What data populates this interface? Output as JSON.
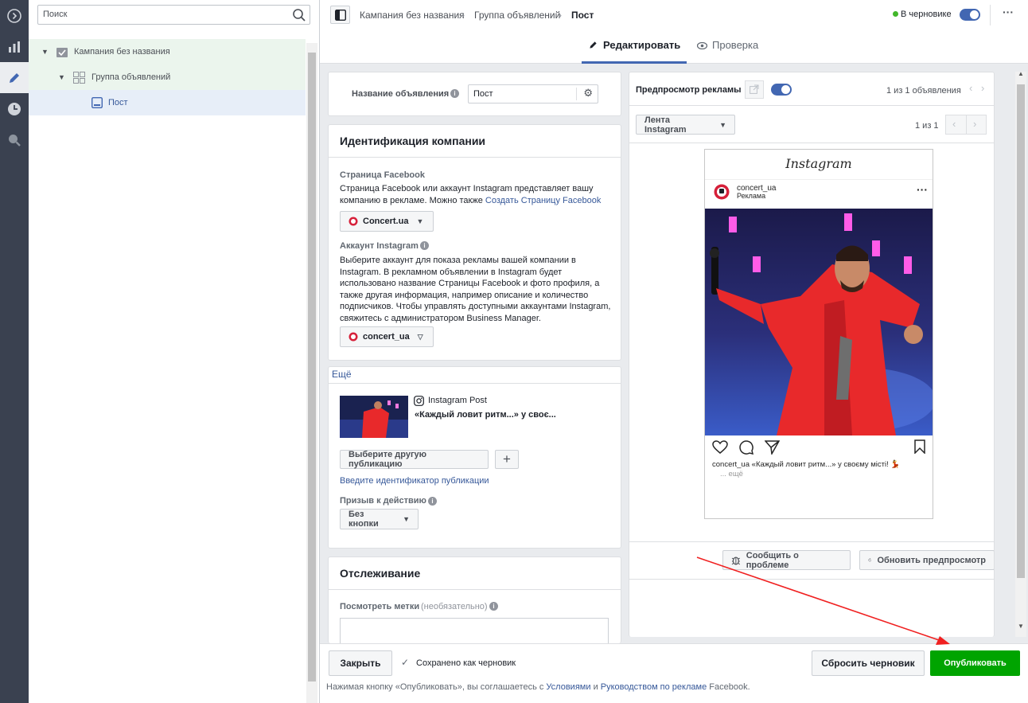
{
  "search": {
    "placeholder": "Поиск"
  },
  "tree": {
    "campaign": "Кампания без названия",
    "adset": "Группа объявлений",
    "ad": "Пост"
  },
  "breadcrumb": {
    "campaign": "Кампания без названия",
    "adset": "Группа объявлений",
    "ad": "Пост"
  },
  "status": {
    "draft": "В черновике"
  },
  "tabs": {
    "edit": "Редактировать",
    "review": "Проверка"
  },
  "adname": {
    "label": "Название объявления",
    "value": "Пост"
  },
  "identity": {
    "title": "Идентификация компании",
    "fb_label": "Страница Facebook",
    "fb_desc": "Страница Facebook или аккаунт Instagram представляет вашу компанию в рекламе. Можно также",
    "fb_link": "Создать Страницу Facebook",
    "fb_page": "Concert.ua",
    "ig_label": "Аккаунт Instagram",
    "ig_desc": "Выберите аккаунт для показа рекламы вашей компании в Instagram. В рекламном объявлении в Instagram будет использовано название Страницы Facebook и фото профиля, а также другая информация, например описание и количество подписчиков. Чтобы управлять доступными аккаунтами Instagram, свяжитесь с администратором Business Manager.",
    "ig_account": "concert_ua"
  },
  "more": {
    "label": "Ещё",
    "post_type": "Instagram Post",
    "post_caption": "«Каждый ловит ритм...» у своє...",
    "choose_btn": "Выберите другую публикацию",
    "enter_id": "Введите идентификатор публикации",
    "cta_label": "Призыв к действию",
    "cta_value": "Без кнопки"
  },
  "tracking": {
    "title": "Отслеживание",
    "tags_label": "Посмотреть метки",
    "tags_optional": "(необязательно)"
  },
  "preview": {
    "title": "Предпросмотр рекламы",
    "count": "1 из 1 объявления",
    "placement": "Лента Instagram",
    "page": "1 из 1",
    "ig_logo": "Instagram",
    "account": "concert_ua",
    "sponsored": "Реклама",
    "caption_user": "concert_ua",
    "caption": "«Каждый ловит ритм...» у своєму місті! 💃",
    "more": "... ещё",
    "report_btn": "Сообщить о проблеме",
    "refresh_btn": "Обновить предпросмотр"
  },
  "footer": {
    "close": "Закрыть",
    "saved": "Сохранено как черновик",
    "discard": "Сбросить черновик",
    "publish": "Опубликовать",
    "terms_1": "Нажимая кнопку «Опубликовать», вы соглашаетесь с",
    "terms_link1": "Условиями",
    "terms_and": "и",
    "terms_link2": "Руководством по рекламе",
    "terms_end": "Facebook."
  },
  "colors": {
    "accent": "#4267b2",
    "publish": "#00a400",
    "annotation": "#f02020"
  }
}
